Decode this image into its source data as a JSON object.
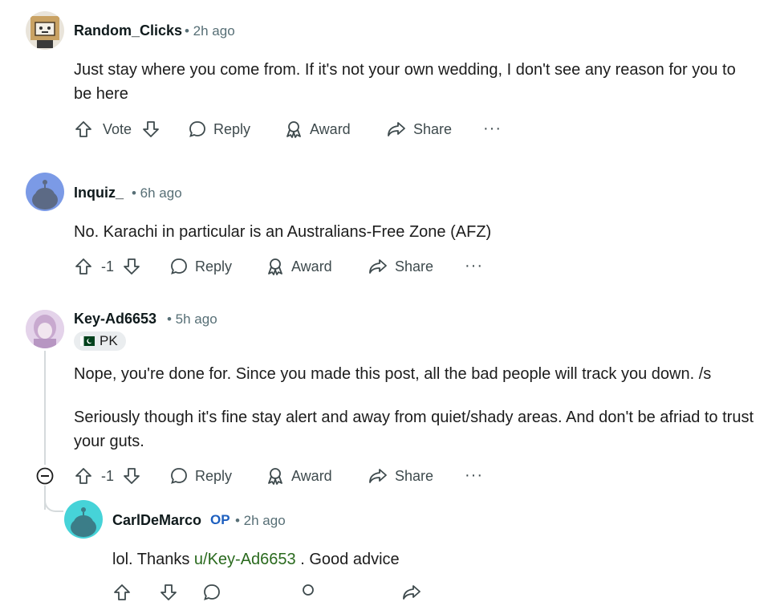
{
  "comments": [
    {
      "username": "Random_Clicks",
      "time": "• 2h ago",
      "body": "Just stay where you come from. If it's not your own wedding, I don't see any reason for you to be here",
      "vote_label": "Vote",
      "actions": {
        "reply": "Reply",
        "award": "Award",
        "share": "Share",
        "more": "···"
      }
    },
    {
      "username": "Inquiz_",
      "time": "• 6h ago",
      "body": "No. Karachi in particular is an Australians-Free Zone (AFZ)",
      "vote_label": "-1",
      "actions": {
        "reply": "Reply",
        "award": "Award",
        "share": "Share",
        "more": "···"
      }
    },
    {
      "username": "Key-Ad6653",
      "time": "• 5h ago",
      "flair": "PK",
      "body_paragraphs": [
        "Nope, you're done for. Since you made this post, all the bad people will track you down. /s",
        "Seriously though it's fine stay alert and away from quiet/shady areas. And don't be afriad to trust your guts."
      ],
      "vote_label": "-1",
      "actions": {
        "reply": "Reply",
        "award": "Award",
        "share": "Share",
        "more": "···"
      }
    },
    {
      "username": "CarlDeMarco",
      "op_badge": "OP",
      "time": "• 2h ago",
      "body_prefix": "lol. Thanks ",
      "mention": "u/Key-Ad6653",
      "body_suffix": " . Good advice"
    }
  ],
  "colors": {
    "op": "#1d5fbf",
    "mention": "#2a6a1e",
    "meta": "#576f76",
    "action": "#3e4a4d"
  }
}
